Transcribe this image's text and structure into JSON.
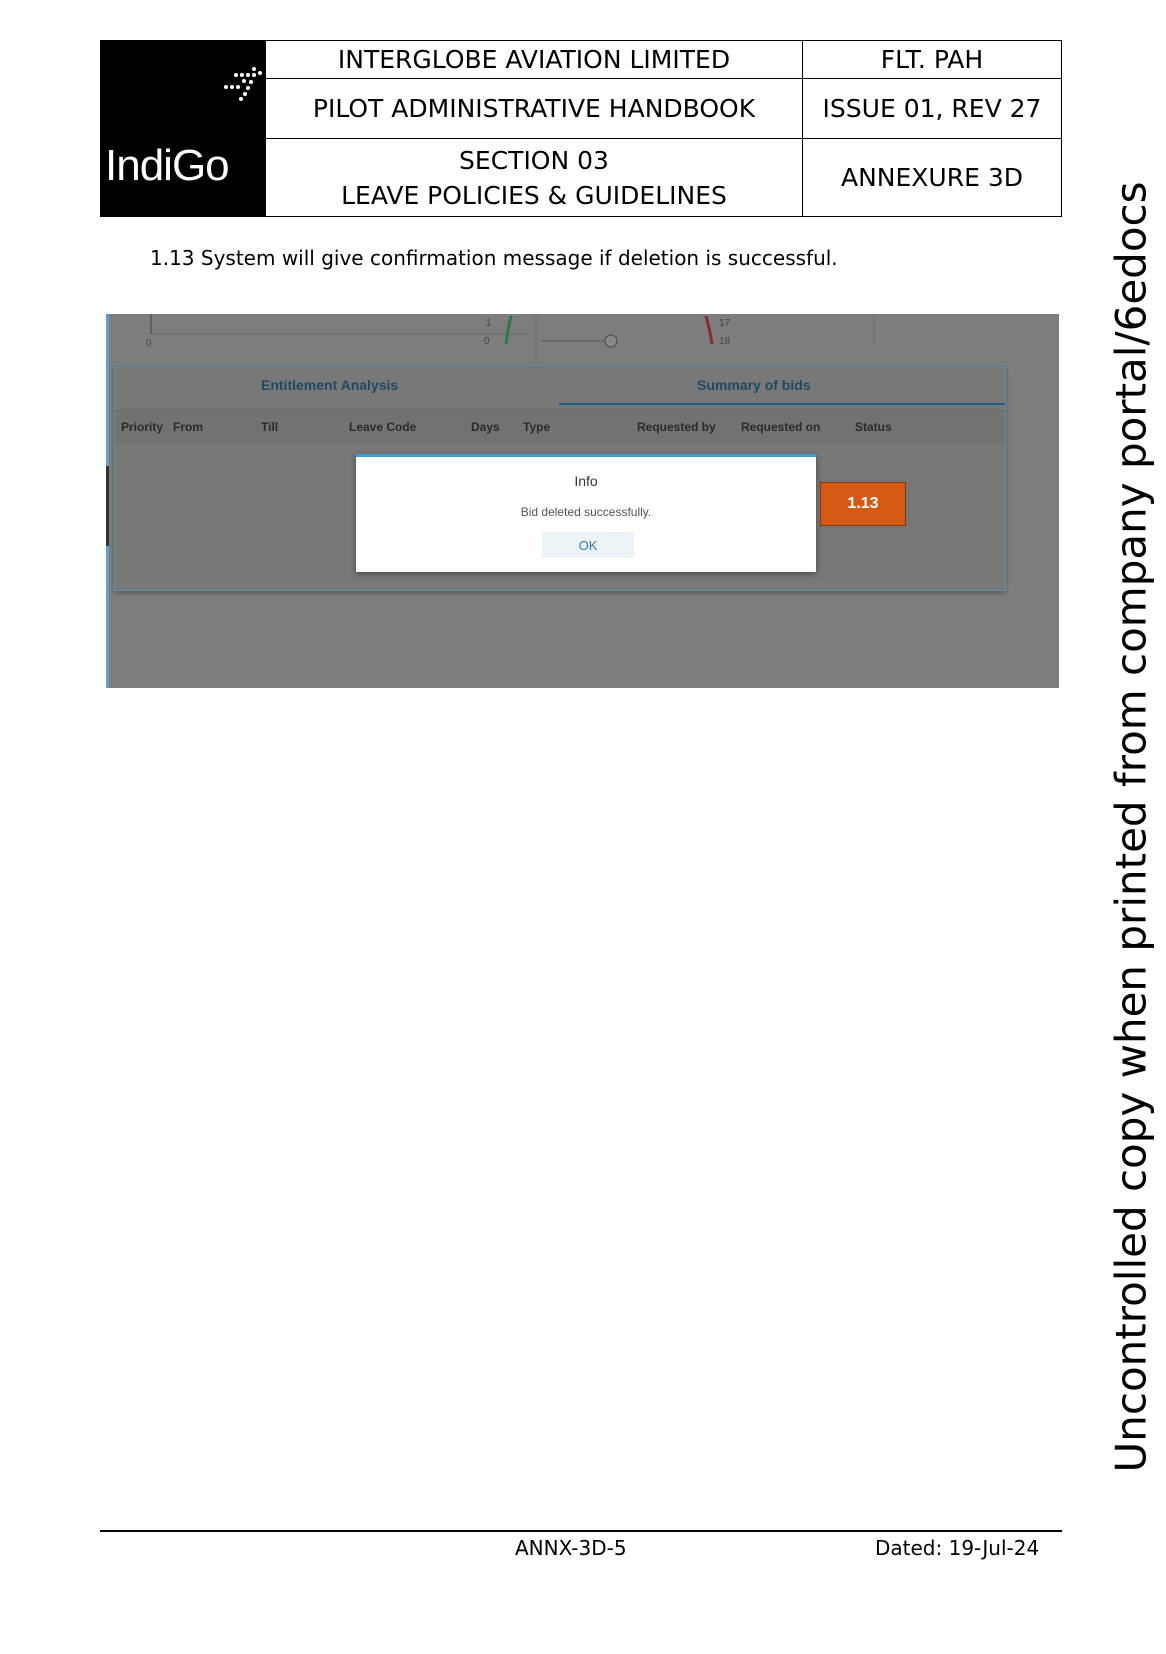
{
  "header": {
    "logo_text": "IndiGo",
    "company": "INTERGLOBE AVIATION LIMITED",
    "doc_code": "FLT. PAH",
    "handbook": "PILOT ADMINISTRATIVE HANDBOOK",
    "issue": "ISSUE 01, REV 27",
    "section": "SECTION 03",
    "section_title": "LEAVE POLICIES & GUIDELINES",
    "annexure": "ANNEXURE 3D"
  },
  "step": "1.13 System will give confirmation message if deletion is successful.",
  "screenshot": {
    "gauge_labels": {
      "a": "0",
      "b": "1",
      "c": "0",
      "d": "17",
      "e": "18"
    },
    "tabs": [
      "Entitlement Analysis",
      "Summary of bids"
    ],
    "columns": [
      "Priority",
      "From",
      "Till",
      "Leave Code",
      "Days",
      "Type",
      "Requested by",
      "Requested on",
      "Status"
    ],
    "dialog": {
      "title": "Info",
      "message": "Bid deleted successfully.",
      "ok_label": "OK"
    },
    "callout": "1.13"
  },
  "footer": {
    "code": "ANNX-3D-5",
    "date": "Dated: 19-Jul-24"
  },
  "watermark": "Uncontrolled copy when printed from company portal/6edocs"
}
